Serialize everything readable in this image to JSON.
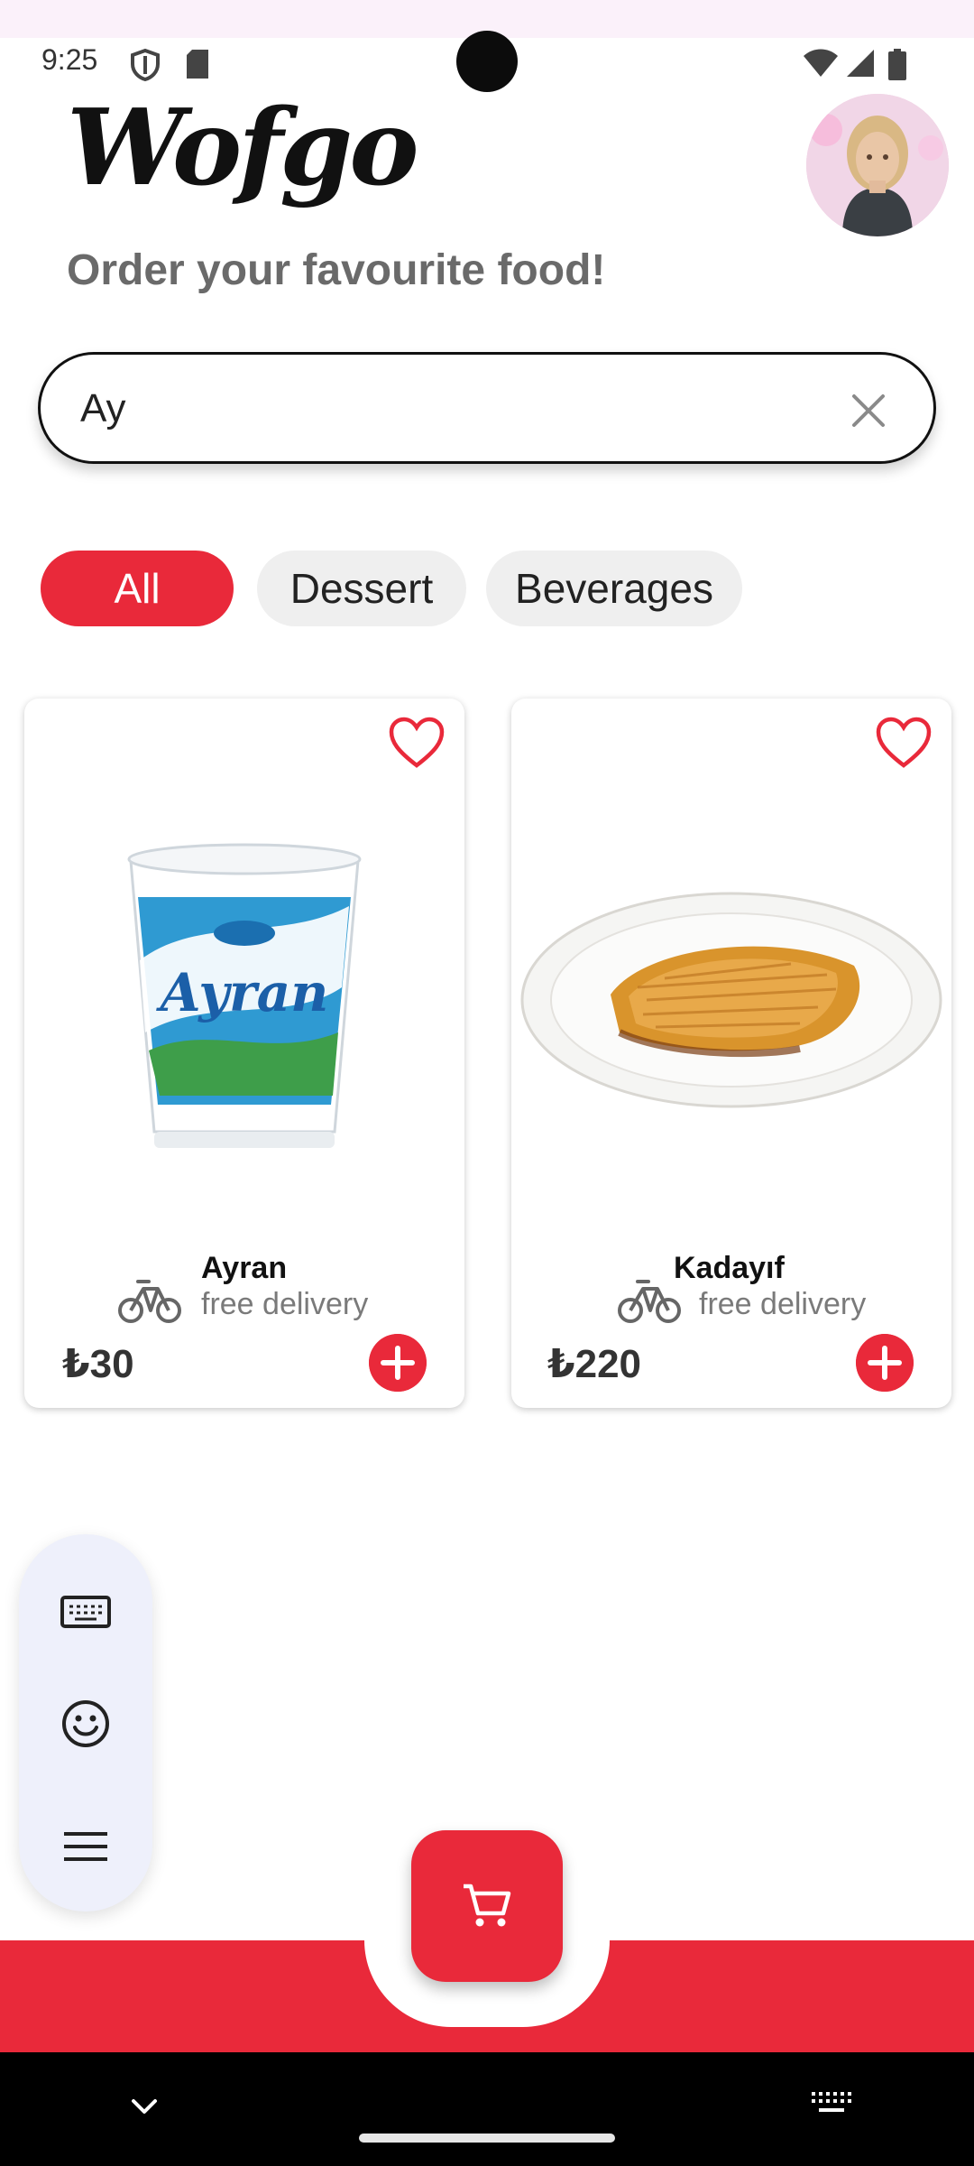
{
  "status_bar": {
    "time": "9:25",
    "icons": [
      "shield-icon",
      "sd-card-icon",
      "wifi-icon",
      "signal-icon",
      "battery-icon"
    ]
  },
  "header": {
    "brand": "Wofgo",
    "tagline": "Order your favourite food!",
    "avatar": "user-avatar"
  },
  "search": {
    "value": "Ay",
    "clear_icon": "close-icon"
  },
  "filters": {
    "chips": [
      {
        "label": "All",
        "active": true
      },
      {
        "label": "Dessert",
        "active": false
      },
      {
        "label": "Beverages",
        "active": false
      }
    ]
  },
  "products": [
    {
      "name": "Ayran",
      "delivery": "free delivery",
      "price": "₺30",
      "favorite_icon": "heart-outline-icon",
      "add_icon": "plus-circle-icon"
    },
    {
      "name": "Kadayıf",
      "delivery": "free delivery",
      "price": "₺220",
      "favorite_icon": "heart-outline-icon",
      "add_icon": "plus-circle-icon"
    }
  ],
  "side_menu": {
    "items": [
      "keyboard-icon",
      "emoji-icon",
      "menu-icon"
    ]
  },
  "bottom": {
    "cart_icon": "cart-icon"
  },
  "colors": {
    "accent": "#e9293a",
    "chip_inactive": "#efefef",
    "text_muted": "#7a7a7a"
  }
}
